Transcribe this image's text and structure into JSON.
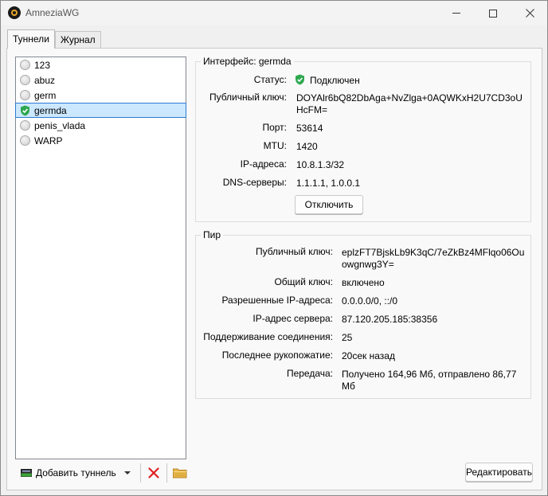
{
  "window": {
    "title": "AmneziaWG"
  },
  "tabs": [
    {
      "label": "Туннели",
      "active": true
    },
    {
      "label": "Журнал",
      "active": false
    }
  ],
  "tunnels": [
    {
      "name": "123",
      "status": "inactive"
    },
    {
      "name": "abuz",
      "status": "inactive"
    },
    {
      "name": "germ",
      "status": "inactive"
    },
    {
      "name": "germda",
      "status": "active"
    },
    {
      "name": "penis_vlada",
      "status": "inactive"
    },
    {
      "name": "WARP",
      "status": "inactive"
    }
  ],
  "interface": {
    "title": "Интерфейс: germda",
    "status_label": "Статус:",
    "status_value": "Подключен",
    "pubkey_label": "Публичный ключ:",
    "pubkey_line1": "DOYAlr6bQ82DbAga+NvZlga+0AQWKxH2U7CD3oU",
    "pubkey_line2": "HcFM=",
    "port_label": "Порт:",
    "port_value": "53614",
    "mtu_label": "MTU:",
    "mtu_value": "1420",
    "ip_label": "IP-адреса:",
    "ip_value": "10.8.1.3/32",
    "dns_label": "DNS-серверы:",
    "dns_value": "1.1.1.1, 1.0.0.1",
    "disconnect_label": "Отключить"
  },
  "peer": {
    "title": "Пир",
    "pubkey_label": "Публичный ключ:",
    "pubkey_line1": "eplzFT7BjskLb9K3qC/7eZkBz4MFlqo06Ou",
    "pubkey_line2": "owgnwg3Y=",
    "psk_label": "Общий ключ:",
    "psk_value": "включено",
    "allowed_label": "Разрешенные IP-адреса:",
    "allowed_value": "0.0.0.0/0, ::/0",
    "endpoint_label": "IP-адрес сервера:",
    "endpoint_value": "87.120.205.185:38356",
    "keepalive_label": "Поддерживание соединения:",
    "keepalive_value": "25",
    "handshake_label": "Последнее рукопожатие:",
    "handshake_value": "20сек назад",
    "transfer_label": "Передача:",
    "transfer_line1": "Получено 164,96 Мб, отправлено 86,77",
    "transfer_line2": "Мб"
  },
  "toolbar": {
    "add_label": "Добавить туннель",
    "edit_label": "Редактировать"
  },
  "colors": {
    "accent": "#2e7bd1",
    "selection": "#cce8ff",
    "connected": "#2fa84f",
    "delete": "#e02020"
  }
}
